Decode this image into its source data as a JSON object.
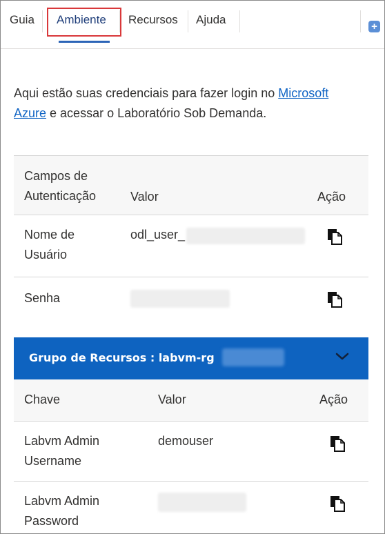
{
  "tabs": [
    {
      "label": "Guia"
    },
    {
      "label": "Ambiente"
    },
    {
      "label": "Recursos"
    },
    {
      "label": "Ajuda"
    }
  ],
  "plus_icon": "plus-icon",
  "intro": {
    "text_before": "Aqui estão suas credenciais para fazer login no ",
    "link": "Microsoft Azure",
    "text_after": " e acessar o Laboratório Sob Demanda."
  },
  "credentials": {
    "headers": {
      "field": "Campos de Autenticação",
      "value": "Valor",
      "action": "Ação"
    },
    "rows": [
      {
        "field": "Nome de Usuário",
        "value": "odl_user_"
      },
      {
        "field": "Senha",
        "value": ""
      }
    ]
  },
  "resource_group": {
    "title": "Grupo de Recursos : labvm-rg",
    "headers": {
      "key": "Chave",
      "value": "Valor",
      "action": "Ação"
    },
    "rows": [
      {
        "key": "Labvm Admin Username",
        "value": "demouser"
      },
      {
        "key": "Labvm Admin Password",
        "value": ""
      }
    ]
  },
  "colors": {
    "accent": "#0e63c0",
    "link": "#1064c4",
    "highlight": "#d9383a"
  }
}
